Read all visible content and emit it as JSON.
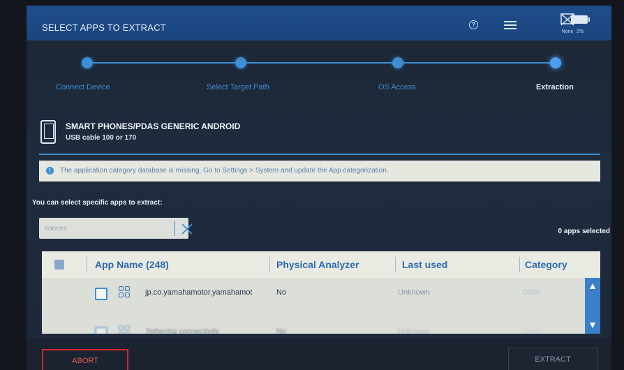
{
  "topbar": {
    "title": "SELECT APPS TO EXTRACT",
    "help_icon": "?",
    "network_label": "None",
    "battery_label": "2%"
  },
  "steps": [
    {
      "label": "Connect Device",
      "active": false
    },
    {
      "label": "Select Target Path",
      "active": false
    },
    {
      "label": "OS Access",
      "active": false
    },
    {
      "label": "Extraction",
      "active": true
    }
  ],
  "device": {
    "title": "SMART PHONES/PDAS GENERIC ANDROID",
    "subtitle": "USB cable 100 or 170"
  },
  "alert": {
    "text": "The application category database is missing. Go to Settings > System and update the App categorization."
  },
  "selection": {
    "prompt": "You can select specific apps to extract:",
    "count_label": "0 apps selected"
  },
  "search": {
    "value": "connec"
  },
  "table": {
    "headers": {
      "app_name": "App Name (248)",
      "physical_analyzer": "Physical Analyzer",
      "last_used": "Last used",
      "category": "Category"
    },
    "rows": [
      {
        "name": "jp.co.yamahamotor.yamahamot",
        "physical_analyzer": "No",
        "last_used": "Unknown",
        "category": "Other"
      },
      {
        "name": "Tethering connectivity",
        "physical_analyzer": "No",
        "last_used": "Unknown",
        "category": "Other"
      }
    ]
  },
  "buttons": {
    "abort": "ABORT",
    "extract": "EXTRACT"
  },
  "colors": {
    "accent": "#3d8ed6",
    "topbar": "#1f4d8a",
    "abort": "#d12a2a"
  }
}
